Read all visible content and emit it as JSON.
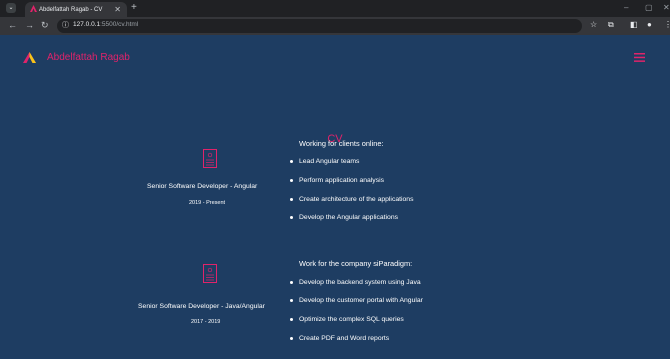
{
  "browser": {
    "tab_title": "Abdelfattah Ragab - CV",
    "url_host": "127.0.0.1",
    "url_rest": ":5500/cv.html"
  },
  "header": {
    "brand": "Abdelfattah Ragab"
  },
  "main": {
    "title": "CV",
    "jobs": [
      {
        "role": "Senior Software Developer - Angular",
        "dates": "2019 - Present",
        "company": "Working for clients online:",
        "tasks": [
          "Lead Angular teams",
          "Perform application analysis",
          "Create architecture of the applications",
          "Develop the Angular applications"
        ]
      },
      {
        "role": "Senior Software Developer - Java/Angular",
        "dates": "2017 - 2019",
        "company": "Work for the company siParadigm:",
        "tasks": [
          "Develop the backend system using Java",
          "Develop the customer portal with Angular",
          "Optimize the complex SQL queries",
          "Create PDF and Word reports"
        ]
      }
    ]
  },
  "colors": {
    "accent": "#e0236a",
    "background": "#1e3d62",
    "text": "#ffffff"
  }
}
